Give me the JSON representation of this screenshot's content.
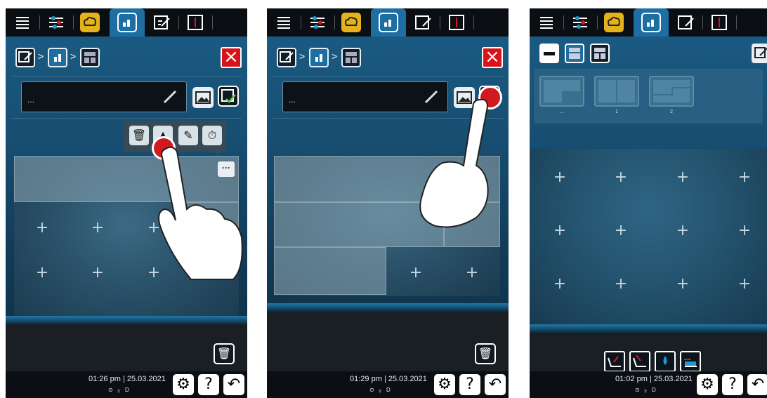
{
  "panels": [
    {
      "id": "left",
      "name_field": {
        "value": "..."
      },
      "footer": {
        "time": "01:26 pm",
        "date": "25.03.2021"
      },
      "icons": [
        "menu-icon",
        "settings-sliders-icon",
        "chef-hat-icon",
        "layout-icon",
        "edit-icon",
        "split-icon"
      ]
    },
    {
      "id": "middle",
      "name_field": {
        "value": "..."
      },
      "footer": {
        "time": "01:29 pm",
        "date": "25.03.2021"
      }
    },
    {
      "id": "right",
      "layout_captions": [
        "...",
        "1",
        "2"
      ],
      "footer": {
        "time": "01:02 pm",
        "date": "25.03.2021"
      }
    }
  ],
  "common": {
    "separator": "|",
    "help_label": "?",
    "back_label": "↶",
    "status_glyphs": "⊙ ⍚ D",
    "more_label": "···",
    "colors": {
      "active_tab": "#1d6fa3",
      "close": "#d8141b",
      "chef_hat": "#e4b21a"
    }
  }
}
